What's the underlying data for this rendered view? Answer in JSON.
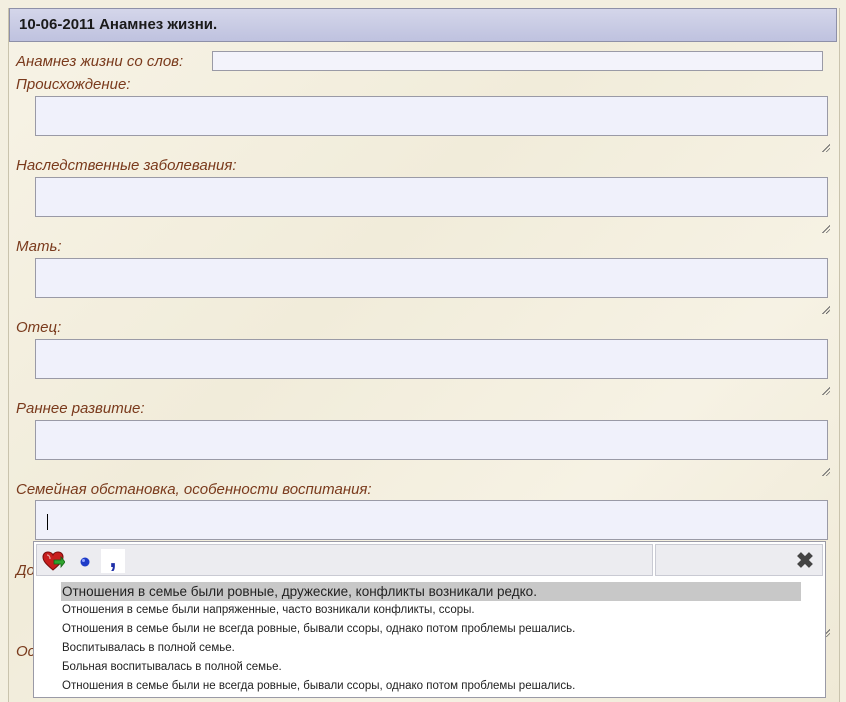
{
  "header": {
    "title": "10-06-2011 Анамнез жизни."
  },
  "fields": {
    "anamnesis_from": "Анамнез жизни со слов:",
    "origin": "Происхождение:",
    "hereditary": "Наследственные заболевания:",
    "mother": "Мать:",
    "father": "Отец:",
    "early_dev": "Раннее развитие:",
    "family": "Семейная обстановка, особенности воспитания:",
    "partial_label_1": "До",
    "partial_label_2": "Ос"
  },
  "values": {
    "anamnesis_from": "",
    "origin": "",
    "hereditary": "",
    "mother": "",
    "father": "",
    "early_dev": "",
    "family": ""
  },
  "autocomplete": {
    "toolbar_icons": [
      "heart-arrow-icon",
      "dot-icon",
      "comma-icon",
      "close-icon"
    ],
    "close_glyph": "✖",
    "comma_glyph": ",",
    "items": [
      "Отношения в семье были ровные, дружеские, конфликты возникали редко.",
      "Отношения в семье были напряженные, часто возникали конфликты, ссоры.",
      "Отношения в семье были не всегда ровные, бывали ссоры, однако потом проблемы решались.",
      "Воспитывалась в полной семье.",
      "Больная воспитывалась в полной семье.",
      "Отношения в семье были не всегда ровные, бывали ссоры, однако потом проблемы решались."
    ],
    "selected_index": 0
  },
  "colors": {
    "label": "#7a3a1c",
    "header_bg": "#c6c8e2",
    "field_bg": "#f0f1fb",
    "selected_bg": "#c8c8c8"
  }
}
